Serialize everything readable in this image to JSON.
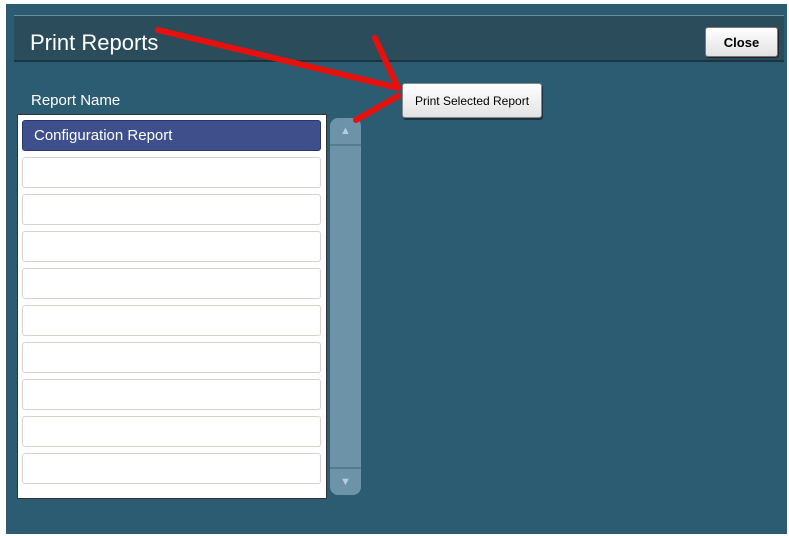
{
  "window": {
    "title": "Print Reports",
    "close_label": "Close"
  },
  "report_list": {
    "header": "Report Name",
    "rows": [
      {
        "label": "Configuration Report",
        "selected": true
      },
      {
        "label": "",
        "selected": false
      },
      {
        "label": "",
        "selected": false
      },
      {
        "label": "",
        "selected": false
      },
      {
        "label": "",
        "selected": false
      },
      {
        "label": "",
        "selected": false
      },
      {
        "label": "",
        "selected": false
      },
      {
        "label": "",
        "selected": false
      },
      {
        "label": "",
        "selected": false
      },
      {
        "label": "",
        "selected": false
      }
    ]
  },
  "actions": {
    "print_selected_label": "Print Selected Report"
  },
  "scrollbar": {
    "up_icon": "triangle-up-icon",
    "down_icon": "triangle-down-icon"
  },
  "annotation": {
    "arrow_color": "#e8100c"
  },
  "colors": {
    "background": "#2c5c72",
    "title_bar": "#2b4c5a",
    "selected_row": "#3e4f8c"
  }
}
